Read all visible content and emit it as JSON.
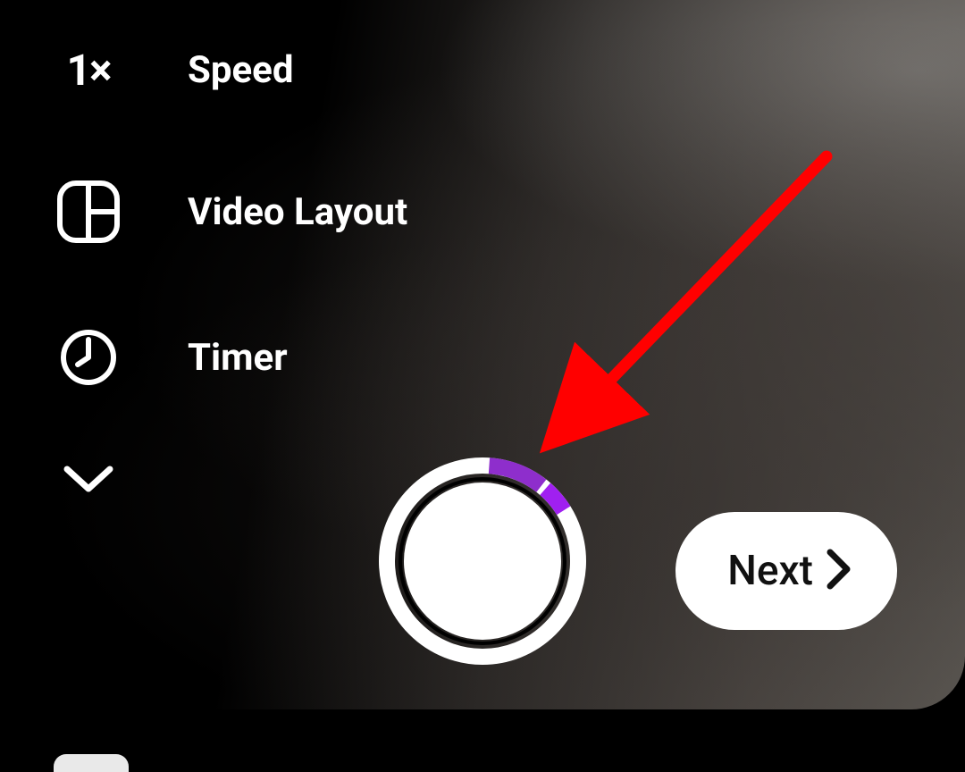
{
  "sidebar": {
    "speed": {
      "icon_text": "1×",
      "label": "Speed"
    },
    "video_layout": {
      "label": "Video Layout"
    },
    "timer": {
      "label": "Timer"
    }
  },
  "record": {
    "progress_segments": [
      {
        "start_deg": 4,
        "end_deg": 38,
        "color": "#8E2ECC"
      },
      {
        "start_deg": 41,
        "end_deg": 58,
        "color": "#A020F0"
      }
    ]
  },
  "next_button": {
    "label": "Next"
  },
  "annotation": {
    "arrow_color": "#FF0000"
  }
}
